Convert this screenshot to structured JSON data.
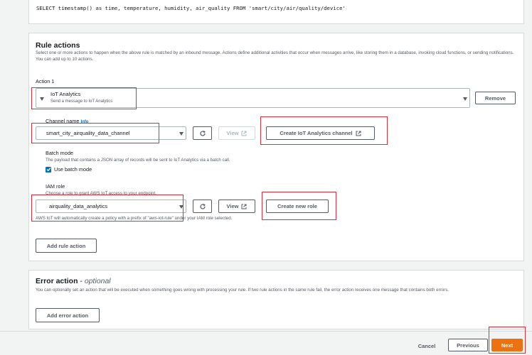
{
  "query": {
    "sql": "SELECT timestamp() as time, temperature, humidity, air_quality FROM 'smart/city/air/quality/device'"
  },
  "rule_actions": {
    "title": "Rule actions",
    "description": "Select one or more actions to happen when the above rule is matched by an inbound message. Actions define additional activities that occur when messages arrive, like storing them in a database, invoking cloud functions, or sending notifications. You can add up to 10 actions.",
    "action_label": "Action 1",
    "action_select": {
      "title": "IoT Analytics",
      "subtitle": "Send a message to IoT Analytics"
    },
    "remove_label": "Remove",
    "channel": {
      "label": "Channel name",
      "info": "Info",
      "value": "smart_city_airquality_data_channel",
      "view_label": "View",
      "create_label": "Create IoT Analytics channel"
    },
    "batch": {
      "label": "Batch mode",
      "description": "The payload that contains a JSON array of records will be sent to IoT Analytics via a batch call.",
      "checkbox_label": "Use batch mode",
      "checked": true
    },
    "iam": {
      "label": "IAM role",
      "description": "Choose a role to grant AWS IoT access to your endpoint.",
      "value": "airquality_data_analytics",
      "view_label": "View",
      "create_label": "Create new role",
      "note": "AWS IoT will automatically create a policy with a prefix of \"aws-iot-rule\" under your IAM role selected."
    },
    "add_label": "Add rule action"
  },
  "error_action": {
    "title": "Error action",
    "optional": "optional",
    "description": "You can optionally set an action that will be executed when something goes wrong with processing your rule. If two rule actions in the same rule fail, the error action receives one message that contains both errors.",
    "add_label": "Add error action"
  },
  "footer": {
    "cancel": "Cancel",
    "previous": "Previous",
    "next": "Next"
  },
  "colors": {
    "primary": "#ec7211",
    "link": "#0073bb",
    "highlight": "#e02d3c"
  }
}
